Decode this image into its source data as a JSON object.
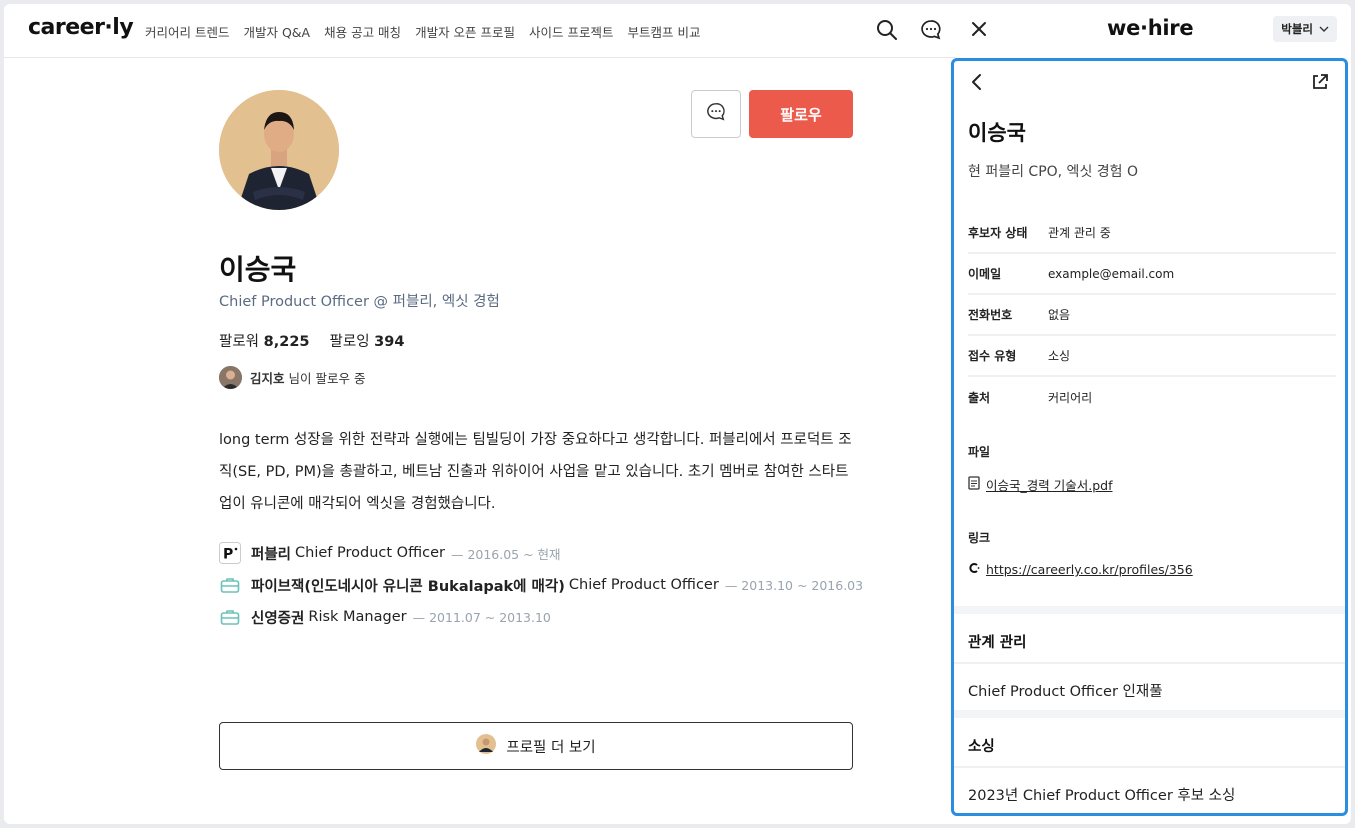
{
  "careerly": {
    "logo": "career·ly",
    "nav": [
      "커리어리 트렌드",
      "개발자 Q&A",
      "채용 공고 매칭",
      "개발자 오픈 프로필",
      "사이드 프로젝트",
      "부트캠프 비교"
    ]
  },
  "profile": {
    "follow_label": "팔로우",
    "name": "이승국",
    "headline": "Chief Product Officer @ 퍼블리, 엑싯 경험",
    "followers_label": "팔로워",
    "followers": "8,225",
    "following_label": "팔로잉",
    "following": "394",
    "followed_by_name": "김지호",
    "followed_by_suffix": "님이 팔로우 중",
    "bio": "long term 성장을 위한 전략과 실행에는 팀빌딩이 가장 중요하다고 생각합니다. 퍼블리에서 프로덕트 조직(SE, PD, PM)을 총괄하고, 베트남 진출과 위하이어 사업을 맡고 있습니다. 초기 멤버로 참여한 스타트업이 유니콘에 매각되어 엑싯을 경험했습니다.",
    "careers": [
      {
        "company": "퍼블리",
        "role": "Chief Product Officer",
        "period": "— 2016.05 ~ 현재",
        "icon": "publy-logo"
      },
      {
        "company": "파이브잭(인도네시아 유니콘 Bukalapak에 매각)",
        "role": "Chief Product Officer",
        "period": "— 2013.10 ~ 2016.03",
        "icon": "briefcase-icon"
      },
      {
        "company": "신영증권",
        "role": "Risk Manager",
        "period": "— 2011.07 ~ 2013.10",
        "icon": "briefcase-icon"
      }
    ],
    "more_label": "프로필 더 보기"
  },
  "wehire": {
    "logo": "we·hire",
    "user": "박블리",
    "name": "이승국",
    "sub": "현 퍼블리 CPO, 엑싯 경험 O",
    "fields": [
      {
        "k": "후보자 상태",
        "v": "관계 관리 중"
      },
      {
        "k": "이메일",
        "v": "example@email.com"
      },
      {
        "k": "전화번호",
        "v": "없음"
      },
      {
        "k": "접수 유형",
        "v": "소싱"
      },
      {
        "k": "출처",
        "v": "커리어리"
      }
    ],
    "file_label": "파일",
    "file_name": "이승국_경력 기술서.pdf",
    "link_label": "링크",
    "link_url": "https://careerly.co.kr/profiles/356",
    "relation_title": "관계 관리",
    "relation_item": "Chief Product Officer 인재풀",
    "sourcing_title": "소싱",
    "sourcing_item": "2023년 Chief Product Officer 후보 소싱"
  },
  "colors": {
    "accent": "#ec5a4b",
    "panel_border": "#2b8de0",
    "headline": "#5b6b82"
  }
}
